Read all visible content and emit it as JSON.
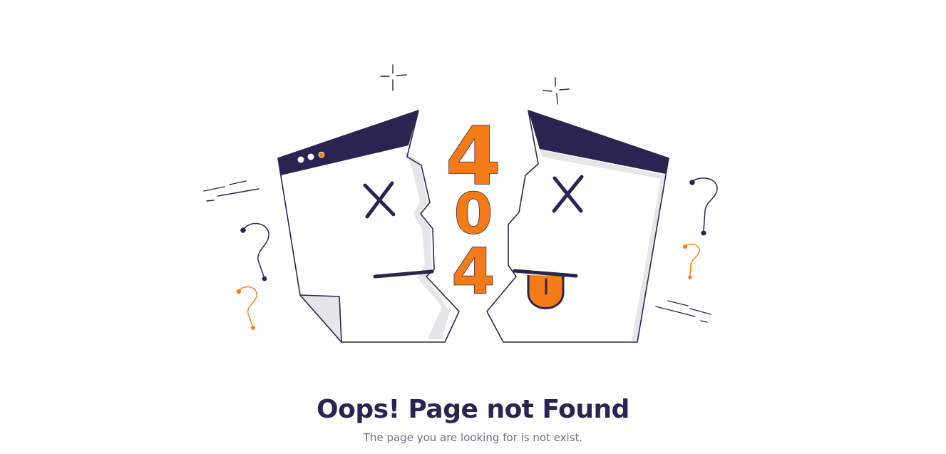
{
  "error_page": {
    "code_digits": [
      "4",
      "0",
      "4"
    ],
    "title": "Oops! Page not Found",
    "message": "The page you are looking for is not exist."
  },
  "colors": {
    "navy": "#2a2550",
    "orange": "#f47b16",
    "paper": "#ffffff",
    "paper_shade": "#e6e6e8",
    "muted_text": "#6b6f82"
  },
  "icons": [
    "broken-browser-left-icon",
    "broken-browser-right-icon",
    "sparkle-icon",
    "question-mark-icon",
    "speed-lines-icon"
  ]
}
